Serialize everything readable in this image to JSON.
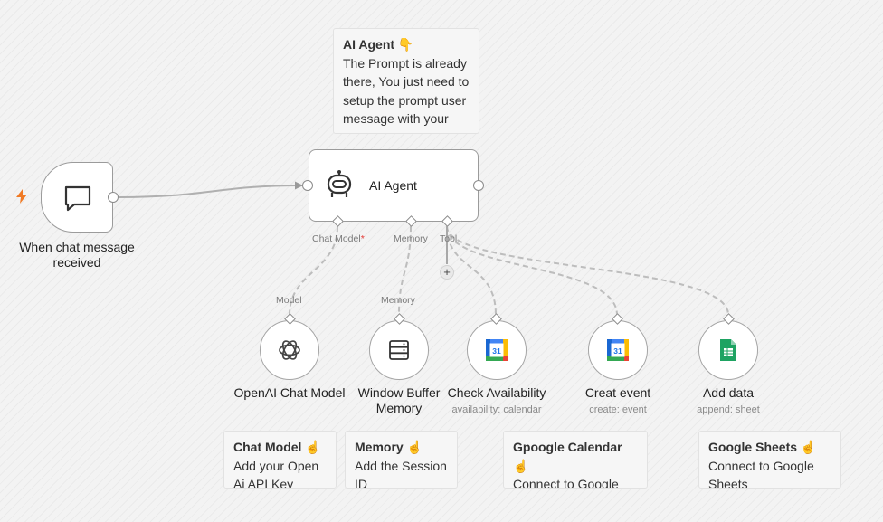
{
  "notes": {
    "agent": {
      "title": "AI Agent 👇",
      "body": "The Prompt is already there, You just need to setup the prompt user message with your text message"
    },
    "chat_model": {
      "title": "Chat Model ☝️",
      "body": "Add your Open Ai API Key"
    },
    "memory": {
      "title": "Memory ☝️",
      "body": "Add the Session ID"
    },
    "calendar": {
      "title": "Gpoogle Calendar ☝️",
      "body": "Connect to Google Calendar"
    },
    "sheets": {
      "title": "Google Sheets ☝️",
      "body": "Connect to Google Sheets"
    }
  },
  "nodes": {
    "trigger": {
      "label": "When chat message received"
    },
    "agent": {
      "label": "AI Agent"
    },
    "openai": {
      "label": "OpenAI Chat Model"
    },
    "buffer": {
      "label": "Window Buffer Memory"
    },
    "check": {
      "label": "Check Availability",
      "sub": "availability: calendar"
    },
    "create": {
      "label": "Creat event",
      "sub": "create: event"
    },
    "add": {
      "label": "Add data",
      "sub": "append: sheet"
    }
  },
  "ports": {
    "chat_model": "Chat Model",
    "required_mark": "*",
    "memory": "Memory",
    "tool": "Tool",
    "model_in": "Model",
    "memory_in": "Memory",
    "add": "+"
  },
  "icons": {
    "trigger": "chat-bubble-icon",
    "agent": "robot-icon",
    "openai": "openai-icon",
    "buffer": "database-icon",
    "calendar": "google-calendar-icon",
    "sheets": "google-sheets-icon",
    "bolt": "lightning-bolt-icon"
  },
  "calendar_day": "31",
  "colors": {
    "bolt": "#f07a25",
    "required": "#e53935",
    "sheets": "#1ea362",
    "edge": "#b4b4b4"
  }
}
